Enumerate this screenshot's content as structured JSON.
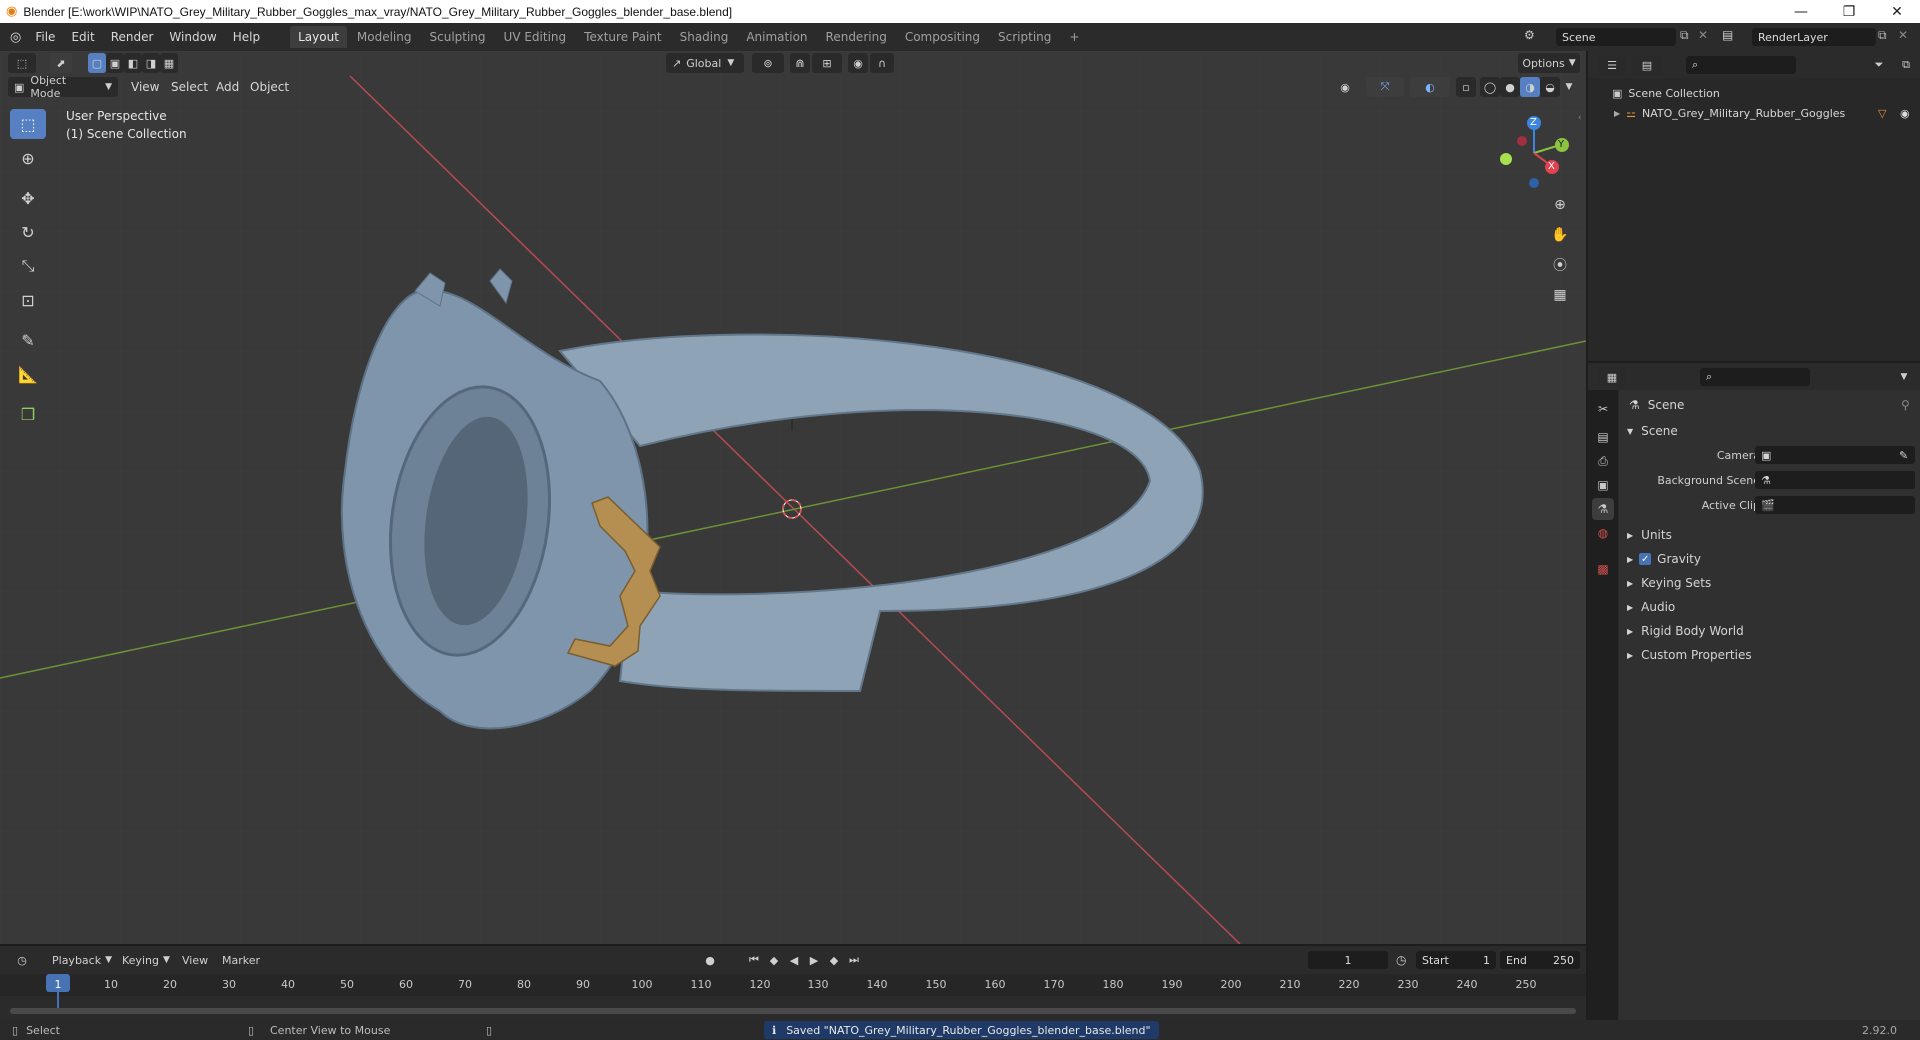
{
  "window": {
    "title": "Blender [E:\\work\\WIP\\NATO_Grey_Military_Rubber_Goggles_max_vray/NATO_Grey_Military_Rubber_Goggles_blender_base.blend]",
    "controls": [
      "—",
      "❐",
      "✕"
    ]
  },
  "menubar": {
    "menus": [
      "File",
      "Edit",
      "Render",
      "Window",
      "Help"
    ],
    "workspaces": [
      "Layout",
      "Modeling",
      "Sculpting",
      "UV Editing",
      "Texture Paint",
      "Shading",
      "Animation",
      "Rendering",
      "Compositing",
      "Scripting"
    ],
    "active_workspace": "Layout",
    "add_tab": "+",
    "scene": "Scene",
    "view_layer": "RenderLayer"
  },
  "viewport": {
    "transform_orientation": "Global",
    "options_label": "Options",
    "mode": "Object Mode",
    "menus": [
      "View",
      "Select",
      "Add",
      "Object"
    ],
    "overlay_line1": "User Perspective",
    "overlay_line2": "(1) Scene Collection",
    "gizmo_axes": [
      "Z",
      "Y",
      "X"
    ],
    "colors": {
      "x_axis": "#e0434e",
      "y_axis": "#8cc341",
      "z_axis": "#3c84e0",
      "active_tool": "#5680c2",
      "background": "#393939",
      "model": "#7f95ab",
      "buckle": "#b58f52"
    }
  },
  "outliner": {
    "root": "Scene Collection",
    "items": [
      {
        "name": "NATO_Grey_Military_Rubber_Goggles"
      }
    ]
  },
  "properties": {
    "context_title": "Scene",
    "panel_title": "Scene",
    "fields": [
      {
        "label": "Camera",
        "value": ""
      },
      {
        "label": "Background Scene",
        "value": ""
      },
      {
        "label": "Active Clip",
        "value": ""
      }
    ],
    "subpanels": [
      "Units",
      "Gravity",
      "Keying Sets",
      "Audio",
      "Rigid Body World",
      "Custom Properties"
    ],
    "gravity_enabled": true
  },
  "timeline": {
    "menus": [
      "Playback",
      "Keying",
      "View",
      "Marker"
    ],
    "current_frame": "1",
    "start_label": "Start",
    "start": "1",
    "end_label": "End",
    "end": "250",
    "ticks": [
      "1",
      "10",
      "20",
      "30",
      "40",
      "50",
      "60",
      "70",
      "80",
      "90",
      "100",
      "110",
      "120",
      "130",
      "140",
      "150",
      "160",
      "170",
      "180",
      "190",
      "200",
      "210",
      "220",
      "230",
      "240",
      "250"
    ]
  },
  "statusbar": {
    "select": "Select",
    "center_view": "Center View to Mouse",
    "message": "Saved \"NATO_Grey_Military_Rubber_Goggles_blender_base.blend\"",
    "version": "2.92.0"
  }
}
